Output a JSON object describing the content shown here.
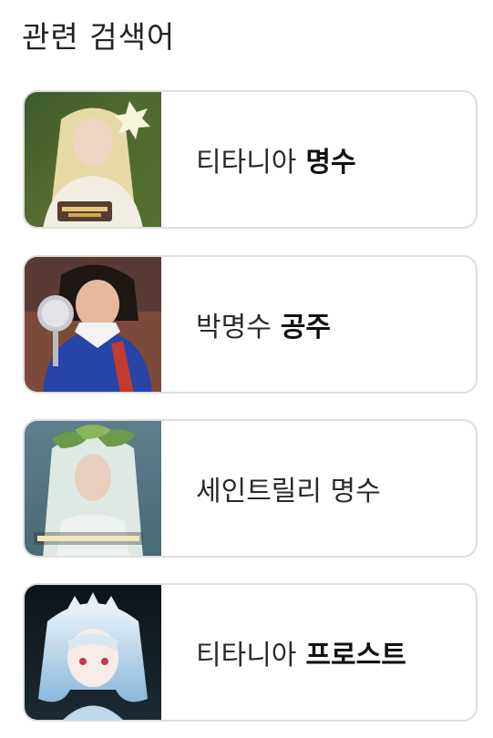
{
  "related": {
    "title": "관련 검색어",
    "items": [
      {
        "plain": "티타니아",
        "bold": "명수",
        "thumb_icon": "person-blonde-flower-crown-photo"
      },
      {
        "plain": "박명수",
        "bold": "공주",
        "thumb_icon": "person-snow-white-mirror-photo"
      },
      {
        "plain": "세인트릴리 명수",
        "bold": "",
        "thumb_icon": "person-white-hair-leaf-crown-photo"
      },
      {
        "plain": "티타니아",
        "bold": "프로스트",
        "thumb_icon": "anime-white-hair-character-art"
      }
    ]
  }
}
